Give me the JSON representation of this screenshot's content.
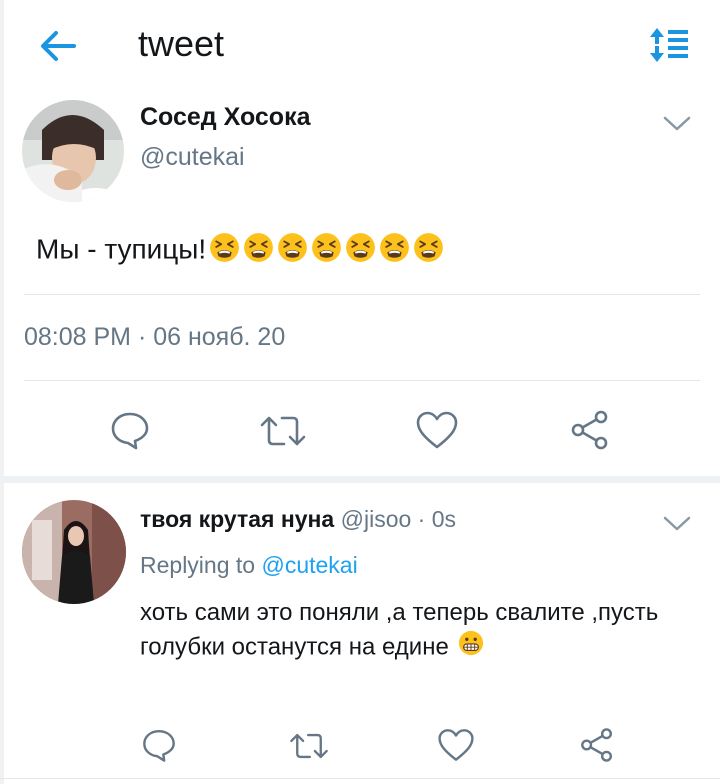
{
  "header": {
    "title": "tweet"
  },
  "tweet": {
    "author_name": "Сосед Хосока",
    "author_handle": "@cutekai",
    "text": "Мы - тупицы!",
    "emoji": [
      "tired-face",
      "tired-face",
      "tired-face",
      "tired-face",
      "tired-face",
      "tired-face",
      "tired-face"
    ],
    "timestamp": "08:08 PM · 06 нояб. 20"
  },
  "reply": {
    "author_name": "твоя крутая нуна",
    "meta": "@jisoo · 0s",
    "replying_prefix": "Replying to",
    "replying_mention": "@cutekai",
    "text": "хоть сами это поняли ,а теперь свалите ,пусть голубки останутся на едине",
    "trailing_emoji": "grimacing-face"
  },
  "colors": {
    "accent": "#1da1f2",
    "icon": "#1b95e0",
    "secondary_text": "#657786",
    "action_icon": "#657786"
  }
}
